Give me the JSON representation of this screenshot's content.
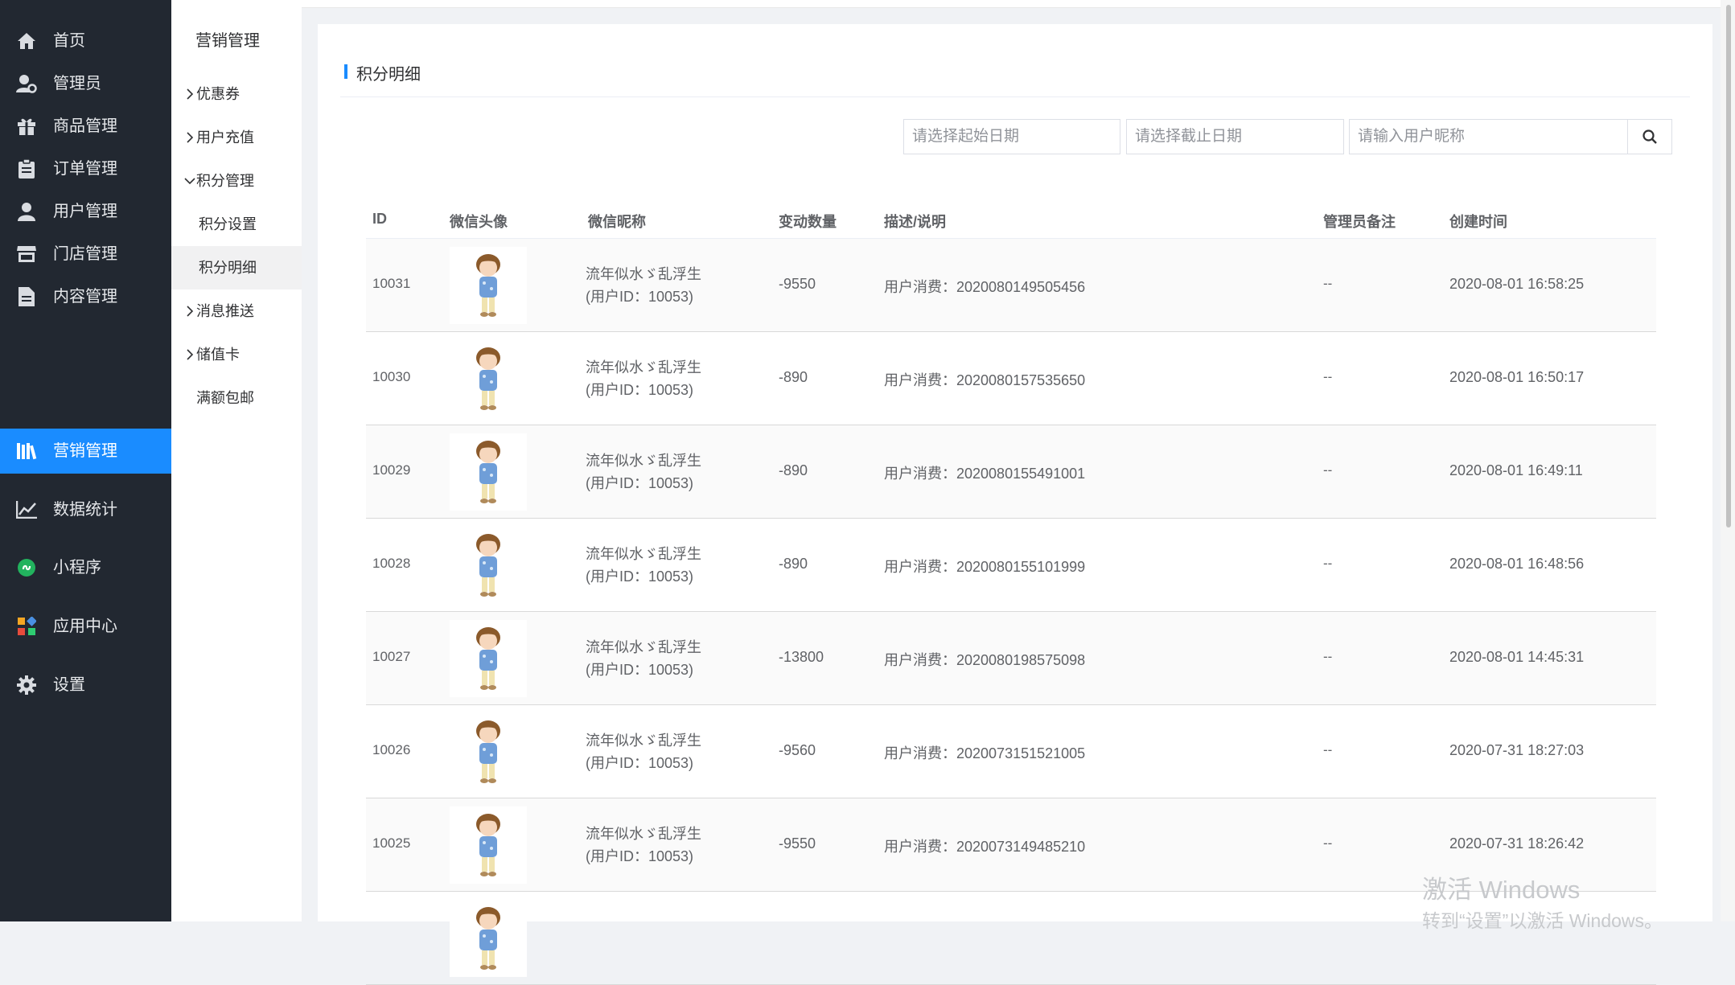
{
  "nav": {
    "items": [
      {
        "label": "首页",
        "icon": "home-icon"
      },
      {
        "label": "管理员",
        "icon": "admin-icon"
      },
      {
        "label": "商品管理",
        "icon": "gift-icon"
      },
      {
        "label": "订单管理",
        "icon": "clipboard-icon"
      },
      {
        "label": "用户管理",
        "icon": "user-icon"
      },
      {
        "label": "门店管理",
        "icon": "store-icon"
      },
      {
        "label": "内容管理",
        "icon": "document-icon"
      },
      {
        "label": "营销管理",
        "icon": "books-icon"
      },
      {
        "label": "数据统计",
        "icon": "chart-icon"
      },
      {
        "label": "小程序",
        "icon": "miniprogram-icon"
      },
      {
        "label": "应用中心",
        "icon": "apps-icon"
      },
      {
        "label": "设置",
        "icon": "gear-icon"
      }
    ],
    "active_index": 7,
    "active_color": "#1a8cff"
  },
  "submenu": {
    "title": "营销管理",
    "items": [
      {
        "label": "优惠券",
        "expandable": true,
        "expanded": false
      },
      {
        "label": "用户充值",
        "expandable": true,
        "expanded": false
      },
      {
        "label": "积分管理",
        "expandable": true,
        "expanded": true
      },
      {
        "label": "积分设置",
        "child": true
      },
      {
        "label": "积分明细",
        "child": true,
        "selected": true
      },
      {
        "label": "消息推送",
        "expandable": true,
        "expanded": false
      },
      {
        "label": "储值卡",
        "expandable": true,
        "expanded": false
      },
      {
        "label": "满额包邮",
        "expandable": false
      }
    ]
  },
  "page": {
    "title": "积分明细"
  },
  "filters": {
    "start_date_placeholder": "请选择起始日期",
    "end_date_placeholder": "请选择截止日期",
    "nickname_placeholder": "请输入用户昵称",
    "search_icon": "search-icon"
  },
  "table": {
    "headers": [
      "ID",
      "微信头像",
      "微信昵称",
      "变动数量",
      "描述/说明",
      "管理员备注",
      "创建时间"
    ],
    "rows": [
      {
        "id": "10031",
        "nickname": "流年似水ゞ乱浮生",
        "user_id": "(用户ID：10053)",
        "change": "-9550",
        "desc": "用户消费：2020080149505456",
        "remark": "--",
        "created": "2020-08-01 16:58:25"
      },
      {
        "id": "10030",
        "nickname": "流年似水ゞ乱浮生",
        "user_id": "(用户ID：10053)",
        "change": "-890",
        "desc": "用户消费：2020080157535650",
        "remark": "--",
        "created": "2020-08-01 16:50:17"
      },
      {
        "id": "10029",
        "nickname": "流年似水ゞ乱浮生",
        "user_id": "(用户ID：10053)",
        "change": "-890",
        "desc": "用户消费：2020080155491001",
        "remark": "--",
        "created": "2020-08-01 16:49:11"
      },
      {
        "id": "10028",
        "nickname": "流年似水ゞ乱浮生",
        "user_id": "(用户ID：10053)",
        "change": "-890",
        "desc": "用户消费：2020080155101999",
        "remark": "--",
        "created": "2020-08-01 16:48:56"
      },
      {
        "id": "10027",
        "nickname": "流年似水ゞ乱浮生",
        "user_id": "(用户ID：10053)",
        "change": "-13800",
        "desc": "用户消费：2020080198575098",
        "remark": "--",
        "created": "2020-08-01 14:45:31"
      },
      {
        "id": "10026",
        "nickname": "流年似水ゞ乱浮生",
        "user_id": "(用户ID：10053)",
        "change": "-9560",
        "desc": "用户消费：2020073151521005",
        "remark": "--",
        "created": "2020-07-31 18:27:03"
      },
      {
        "id": "10025",
        "nickname": "流年似水ゞ乱浮生",
        "user_id": "(用户ID：10053)",
        "change": "-9550",
        "desc": "用户消费：2020073149485210",
        "remark": "--",
        "created": "2020-07-31 18:26:42"
      },
      {
        "id": "",
        "nickname": "",
        "user_id": "",
        "change": "",
        "desc": "",
        "remark": "",
        "created": ""
      }
    ]
  },
  "watermark": {
    "line1": "激活 Windows",
    "line2": "转到“设置”以激活 Windows。"
  }
}
